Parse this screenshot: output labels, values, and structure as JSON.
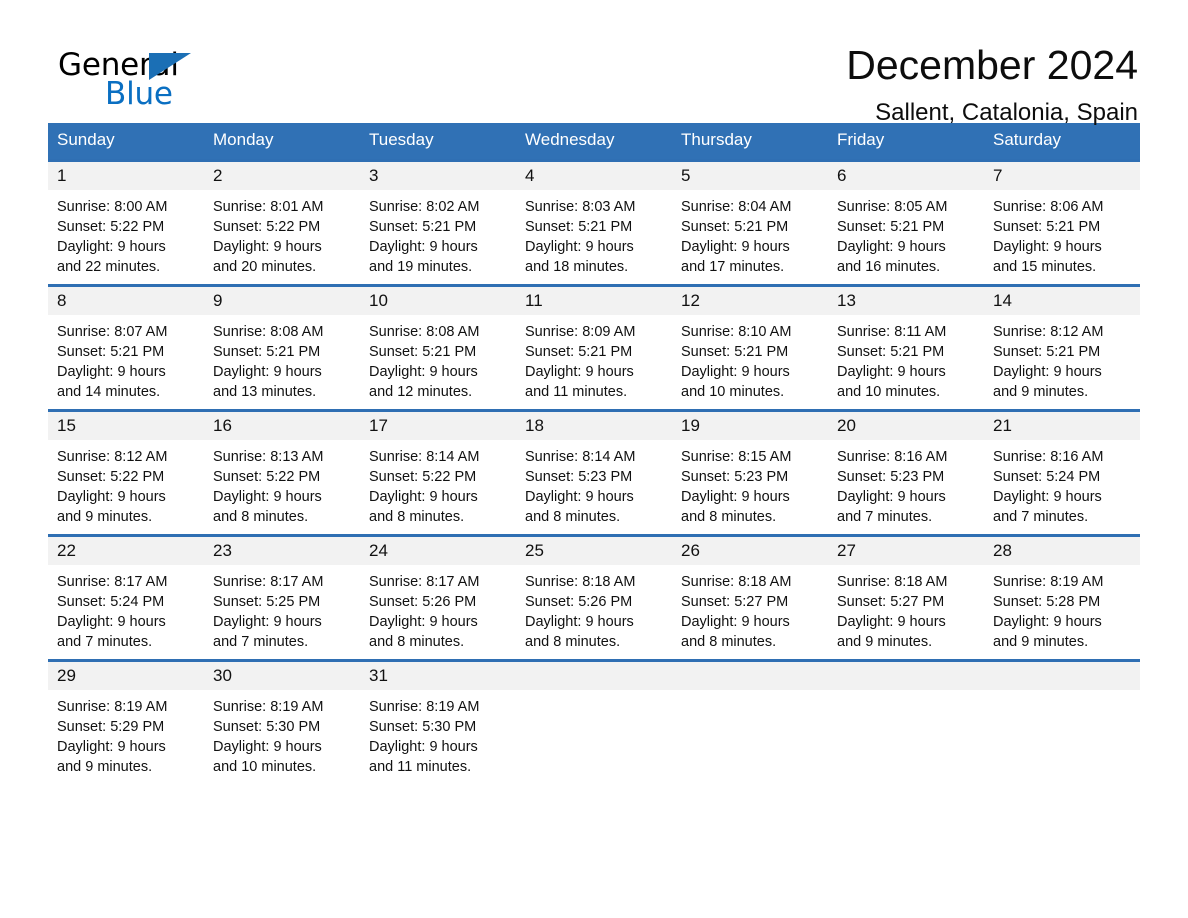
{
  "brand": {
    "name_top": "General",
    "name_bottom": "Blue",
    "accent_color": "#0a6fc2",
    "triangle_color": "#1b6fb5"
  },
  "header": {
    "title": "December 2024",
    "subtitle": "Sallent, Catalonia, Spain"
  },
  "theme": {
    "header_row_bg": "#3071b5",
    "row_divider": "#2f6fb3",
    "day_number_bg": "#f2f2f2",
    "text": "#111111"
  },
  "weekdays": [
    "Sunday",
    "Monday",
    "Tuesday",
    "Wednesday",
    "Thursday",
    "Friday",
    "Saturday"
  ],
  "weeks": [
    [
      {
        "day": "1",
        "info": "Sunrise: 8:00 AM\nSunset: 5:22 PM\nDaylight: 9 hours\nand 22 minutes."
      },
      {
        "day": "2",
        "info": "Sunrise: 8:01 AM\nSunset: 5:22 PM\nDaylight: 9 hours\nand 20 minutes."
      },
      {
        "day": "3",
        "info": "Sunrise: 8:02 AM\nSunset: 5:21 PM\nDaylight: 9 hours\nand 19 minutes."
      },
      {
        "day": "4",
        "info": "Sunrise: 8:03 AM\nSunset: 5:21 PM\nDaylight: 9 hours\nand 18 minutes."
      },
      {
        "day": "5",
        "info": "Sunrise: 8:04 AM\nSunset: 5:21 PM\nDaylight: 9 hours\nand 17 minutes."
      },
      {
        "day": "6",
        "info": "Sunrise: 8:05 AM\nSunset: 5:21 PM\nDaylight: 9 hours\nand 16 minutes."
      },
      {
        "day": "7",
        "info": "Sunrise: 8:06 AM\nSunset: 5:21 PM\nDaylight: 9 hours\nand 15 minutes."
      }
    ],
    [
      {
        "day": "8",
        "info": "Sunrise: 8:07 AM\nSunset: 5:21 PM\nDaylight: 9 hours\nand 14 minutes."
      },
      {
        "day": "9",
        "info": "Sunrise: 8:08 AM\nSunset: 5:21 PM\nDaylight: 9 hours\nand 13 minutes."
      },
      {
        "day": "10",
        "info": "Sunrise: 8:08 AM\nSunset: 5:21 PM\nDaylight: 9 hours\nand 12 minutes."
      },
      {
        "day": "11",
        "info": "Sunrise: 8:09 AM\nSunset: 5:21 PM\nDaylight: 9 hours\nand 11 minutes."
      },
      {
        "day": "12",
        "info": "Sunrise: 8:10 AM\nSunset: 5:21 PM\nDaylight: 9 hours\nand 10 minutes."
      },
      {
        "day": "13",
        "info": "Sunrise: 8:11 AM\nSunset: 5:21 PM\nDaylight: 9 hours\nand 10 minutes."
      },
      {
        "day": "14",
        "info": "Sunrise: 8:12 AM\nSunset: 5:21 PM\nDaylight: 9 hours\nand 9 minutes."
      }
    ],
    [
      {
        "day": "15",
        "info": "Sunrise: 8:12 AM\nSunset: 5:22 PM\nDaylight: 9 hours\nand 9 minutes."
      },
      {
        "day": "16",
        "info": "Sunrise: 8:13 AM\nSunset: 5:22 PM\nDaylight: 9 hours\nand 8 minutes."
      },
      {
        "day": "17",
        "info": "Sunrise: 8:14 AM\nSunset: 5:22 PM\nDaylight: 9 hours\nand 8 minutes."
      },
      {
        "day": "18",
        "info": "Sunrise: 8:14 AM\nSunset: 5:23 PM\nDaylight: 9 hours\nand 8 minutes."
      },
      {
        "day": "19",
        "info": "Sunrise: 8:15 AM\nSunset: 5:23 PM\nDaylight: 9 hours\nand 8 minutes."
      },
      {
        "day": "20",
        "info": "Sunrise: 8:16 AM\nSunset: 5:23 PM\nDaylight: 9 hours\nand 7 minutes."
      },
      {
        "day": "21",
        "info": "Sunrise: 8:16 AM\nSunset: 5:24 PM\nDaylight: 9 hours\nand 7 minutes."
      }
    ],
    [
      {
        "day": "22",
        "info": "Sunrise: 8:17 AM\nSunset: 5:24 PM\nDaylight: 9 hours\nand 7 minutes."
      },
      {
        "day": "23",
        "info": "Sunrise: 8:17 AM\nSunset: 5:25 PM\nDaylight: 9 hours\nand 7 minutes."
      },
      {
        "day": "24",
        "info": "Sunrise: 8:17 AM\nSunset: 5:26 PM\nDaylight: 9 hours\nand 8 minutes."
      },
      {
        "day": "25",
        "info": "Sunrise: 8:18 AM\nSunset: 5:26 PM\nDaylight: 9 hours\nand 8 minutes."
      },
      {
        "day": "26",
        "info": "Sunrise: 8:18 AM\nSunset: 5:27 PM\nDaylight: 9 hours\nand 8 minutes."
      },
      {
        "day": "27",
        "info": "Sunrise: 8:18 AM\nSunset: 5:27 PM\nDaylight: 9 hours\nand 9 minutes."
      },
      {
        "day": "28",
        "info": "Sunrise: 8:19 AM\nSunset: 5:28 PM\nDaylight: 9 hours\nand 9 minutes."
      }
    ],
    [
      {
        "day": "29",
        "info": "Sunrise: 8:19 AM\nSunset: 5:29 PM\nDaylight: 9 hours\nand 9 minutes."
      },
      {
        "day": "30",
        "info": "Sunrise: 8:19 AM\nSunset: 5:30 PM\nDaylight: 9 hours\nand 10 minutes."
      },
      {
        "day": "31",
        "info": "Sunrise: 8:19 AM\nSunset: 5:30 PM\nDaylight: 9 hours\nand 11 minutes."
      },
      {
        "day": "",
        "info": ""
      },
      {
        "day": "",
        "info": ""
      },
      {
        "day": "",
        "info": ""
      },
      {
        "day": "",
        "info": ""
      }
    ]
  ]
}
